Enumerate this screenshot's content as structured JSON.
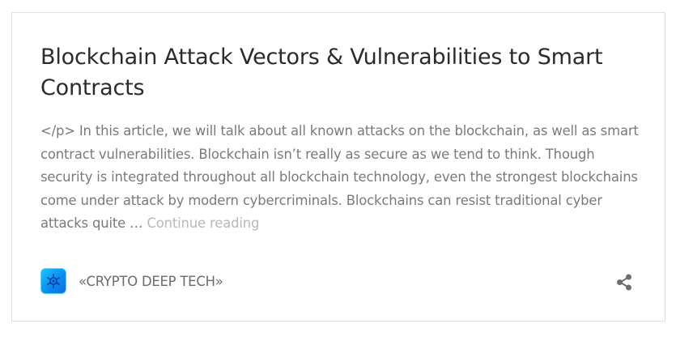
{
  "post": {
    "title": "Blockchain Attack Vectors & Vulnerabilities to Smart Contracts",
    "excerpt": "</p> In this article, we will talk about all known attacks on the blockchain, as well as smart contract vulnerabilities. Blockchain isn’t really as secure as we tend to think. Though security is integrated throughout all blockchain technology, even the strongest blockchains come under attack by modern cybercriminals. Blockchains can resist traditional cyber attacks quite … ",
    "continue_label": "Continue reading"
  },
  "author": {
    "name": "«CRYPTO DEEP TECH»",
    "avatar_icon": "crypto-logo-icon"
  },
  "actions": {
    "share_icon": "share-icon"
  },
  "colors": {
    "title": "#2b2b2b",
    "excerpt": "#7a7a7a",
    "continue_link": "#b8b8b8",
    "author": "#6b6b6b",
    "avatar_accent": "#0a8df0",
    "card_border": "#dedede"
  }
}
